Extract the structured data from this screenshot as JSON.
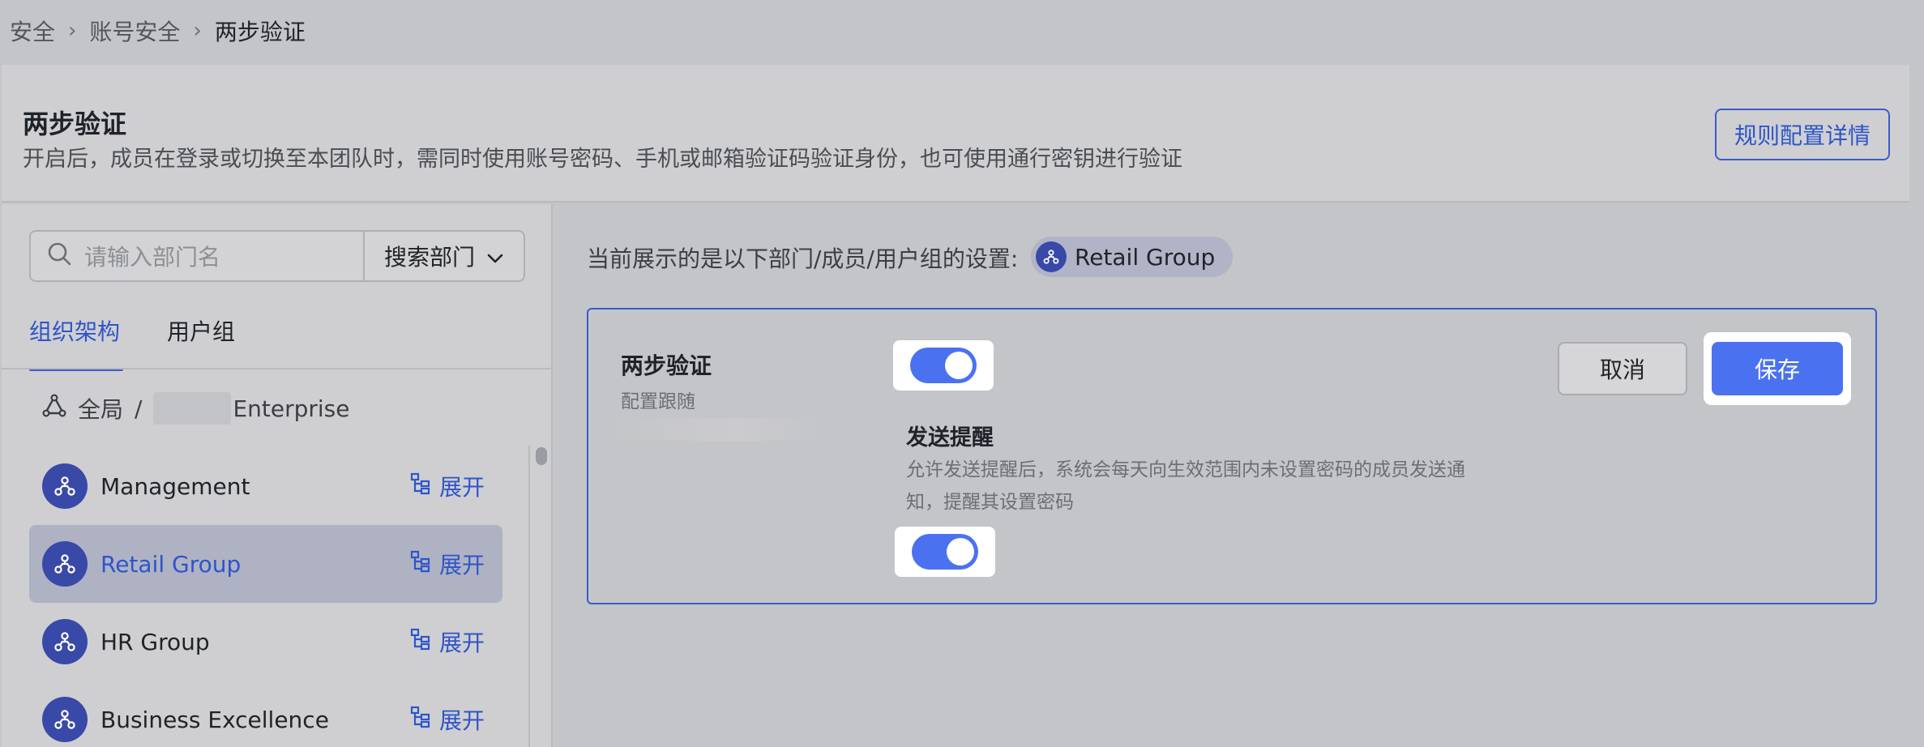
{
  "breadcrumb": {
    "items": [
      "安全",
      "账号安全",
      "两步验证"
    ],
    "separator": ">"
  },
  "header": {
    "title": "两步验证",
    "description": "开启后，成员在登录或切换至本团队时，需同时使用账号密码、手机或邮箱验证码验证身份，也可使用通行密钥进行验证",
    "rules_button": "规则配置详情"
  },
  "sidebar": {
    "search": {
      "placeholder": "请输入部门名",
      "scope_label": "搜索部门"
    },
    "tabs": [
      {
        "label": "组织架构",
        "active": true
      },
      {
        "label": "用户组",
        "active": false
      }
    ],
    "scope": {
      "label": "全局",
      "separator": "/",
      "org_name": "Enterprise"
    },
    "departments": [
      {
        "name": "Management",
        "expand_label": "展开",
        "selected": false
      },
      {
        "name": "Retail Group",
        "expand_label": "展开",
        "selected": true
      },
      {
        "name": "HR Group",
        "expand_label": "展开",
        "selected": false
      },
      {
        "name": "Business Excellence",
        "expand_label": "展开",
        "selected": false
      }
    ]
  },
  "main": {
    "current_label": "当前展示的是以下部门/成员/用户组的设置:",
    "current_target": "Retail Group",
    "settings": {
      "two_step": {
        "title": "两步验证",
        "subtitle": "配置跟随",
        "enabled": true
      },
      "reminder": {
        "title": "发送提醒",
        "description_line1": "允许发送提醒后，系统会每天向生效范围内未设置密码的成员发送通",
        "description_line2": "知，提醒其设置密码",
        "enabled": true
      },
      "cancel_label": "取消",
      "save_label": "保存"
    }
  },
  "colors": {
    "accent": "#4a72f0",
    "link": "#2e55c9",
    "avatar": "#3949a8",
    "background": "#c4c5c9"
  }
}
